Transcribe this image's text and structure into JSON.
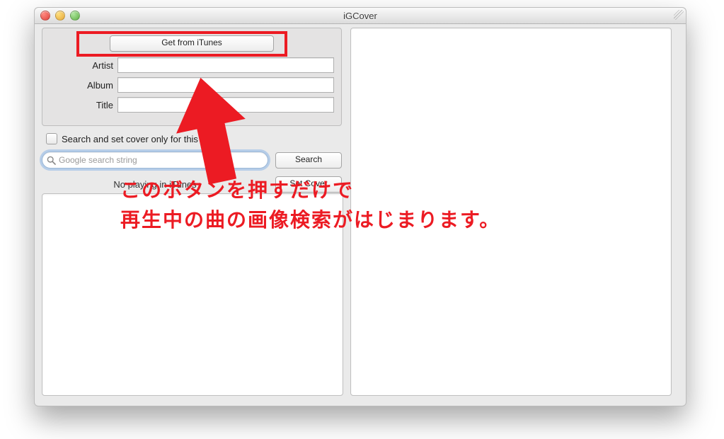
{
  "window": {
    "title": "iGCover"
  },
  "form": {
    "getFromItunes": "Get from iTunes",
    "artistLabel": "Artist",
    "albumLabel": "Album",
    "titleLabel": "Title"
  },
  "checkbox": {
    "label": "Search and set cover only for this track"
  },
  "search": {
    "placeholder": "Google search string",
    "searchLabel": "Search",
    "setCoverLabel": "Set Cover"
  },
  "status": {
    "text": "No playing in iTunes"
  },
  "annotation": {
    "line1": "このボタンを押すだけで",
    "line2": "再生中の曲の画像検索がはじまります。"
  }
}
